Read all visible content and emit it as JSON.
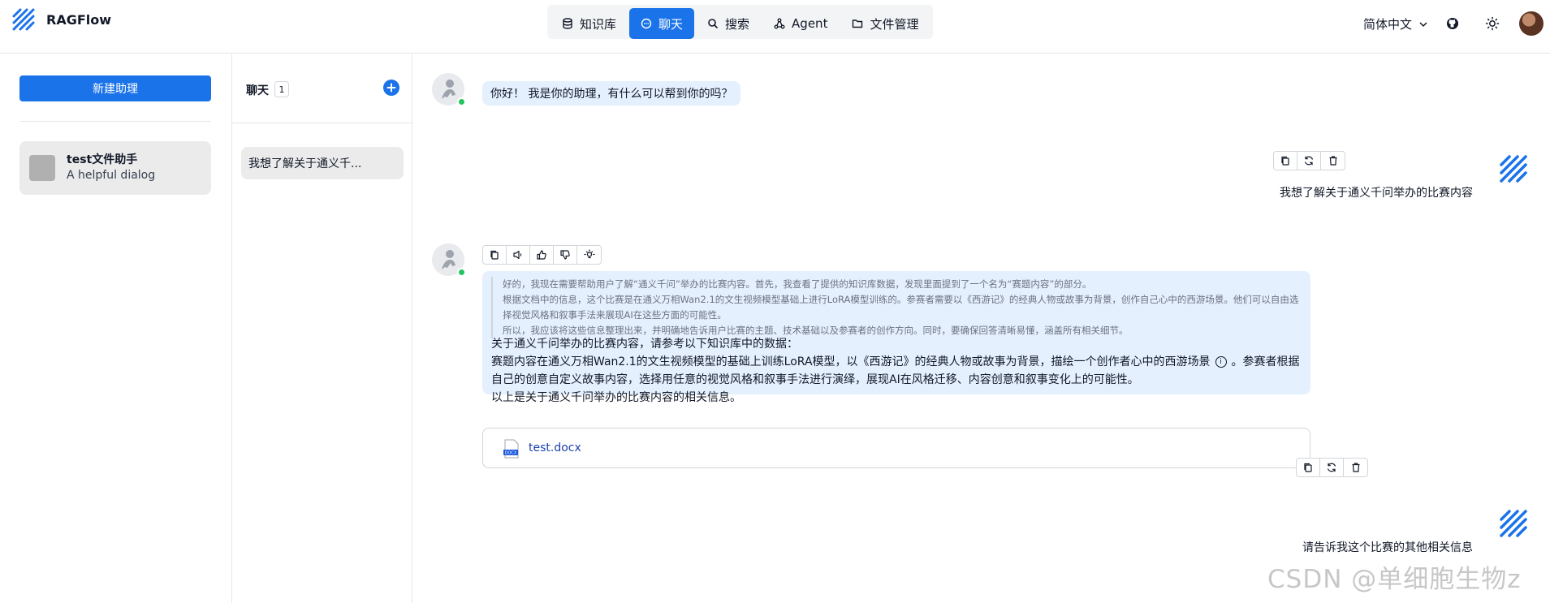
{
  "app": {
    "name": "RAGFlow"
  },
  "nav": {
    "items": [
      {
        "label": "知识库",
        "icon": "database-icon"
      },
      {
        "label": "聊天",
        "icon": "chat-icon",
        "active": true
      },
      {
        "label": "搜索",
        "icon": "search-icon"
      },
      {
        "label": "Agent",
        "icon": "agent-icon"
      },
      {
        "label": "文件管理",
        "icon": "folder-icon"
      }
    ]
  },
  "header": {
    "language": "简体中文"
  },
  "assistants": {
    "new_button": "新建助理",
    "items": [
      {
        "name": "test文件助手",
        "description": "A helpful dialog"
      }
    ]
  },
  "conversations": {
    "title": "聊天",
    "count": "1",
    "items": [
      {
        "label": "我想了解关于通义千..."
      }
    ]
  },
  "messages": {
    "greeting": "你好！ 我是你的助理，有什么可以帮到你的吗？",
    "user1": "我想了解关于通义千问举办的比赛内容",
    "thinking": [
      "好的，我现在需要帮助用户了解“通义千问”举办的比赛内容。首先，我查看了提供的知识库数据，发现里面提到了一个名为“赛题内容”的部分。",
      "根据文档中的信息，这个比赛是在通义万相Wan2.1的文生视频模型基础上进行LoRA模型训练的。参赛者需要以《西游记》的经典人物或故事为背景，创作自己心中的西游场景。他们可以自由选择视觉风格和叙事手法来展现AI在这些方面的可能性。",
      "所以，我应该将这些信息整理出来，并明确地告诉用户比赛的主题、技术基础以及参赛者的创作方向。同时，要确保回答清晰易懂，涵盖所有相关细节。"
    ],
    "answer_lines": [
      "关于通义千问举办的比赛内容，请参考以下知识库中的数据：",
      "赛题内容在通义万相Wan2.1的文生视频模型的基础上训练LoRA模型，以《西游记》的经典人物或故事为背景，描绘一个创作者心中的西游场景",
      "。参赛者根据",
      "自己的创意自定义故事内容，选择用任意的视觉风格和叙事手法进行演绎，展现AI在风格迁移、内容创意和叙事变化上的可能性。",
      "以上是关于通义千问举办的比赛内容的相关信息。"
    ],
    "info_marker": "i",
    "file": "test.docx",
    "file_type": "DOCX",
    "user2": "请告诉我这个比赛的其他相关信息"
  },
  "watermark": "CSDN @单细胞生物z",
  "colors": {
    "accent": "#1a73e8",
    "bot_bubble": "#e5f0fe",
    "online": "#22c55e"
  }
}
